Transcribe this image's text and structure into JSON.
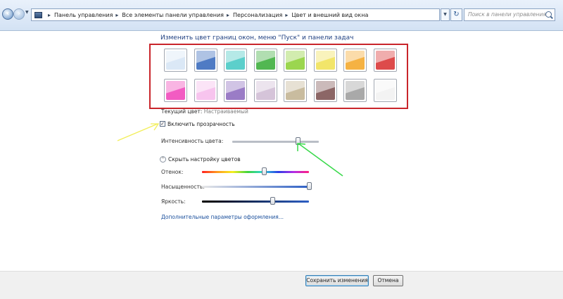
{
  "breadcrumb": [
    "Панель управления",
    "Все элементы панели управления",
    "Персонализация",
    "Цвет и внешний вид окна"
  ],
  "search": {
    "placeholder": "Поиск в панели управления"
  },
  "heading": "Изменить цвет границ окон, меню \"Пуск\" и панели задач",
  "swatches": [
    {
      "color": "#dbe8f6"
    },
    {
      "color": "#4f7bc4"
    },
    {
      "color": "#5ccfcb"
    },
    {
      "color": "#52b752"
    },
    {
      "color": "#9bd64f"
    },
    {
      "color": "#f2e56a"
    },
    {
      "color": "#f5b243"
    },
    {
      "color": "#dd4b4b"
    },
    {
      "color": "#f25cc2"
    },
    {
      "color": "#f7c4ee"
    },
    {
      "color": "#9a7cc6"
    },
    {
      "color": "#d5c4d9"
    },
    {
      "color": "#c9bc9f"
    },
    {
      "color": "#8c6666"
    },
    {
      "color": "#a9a9a9"
    },
    {
      "color": "#f3f3f3"
    }
  ],
  "current_color": {
    "label": "Текущий цвет:",
    "value": "Настраиваемый"
  },
  "transparency": {
    "label": "Включить прозрачность",
    "checked": true
  },
  "intensity": {
    "label": "Интенсивность цвета:",
    "value_percent": 76
  },
  "collapse": {
    "label": "Скрыть настройку цветов"
  },
  "hue": {
    "label": "Отенок:",
    "value_percent": 58
  },
  "saturation": {
    "label": "Насыщенность:",
    "value_percent": 100
  },
  "brightness": {
    "label": "Яркость:",
    "value_percent": 66
  },
  "advanced_link": "Дополнительные параметры оформления...",
  "buttons": {
    "save": "Сохранить изменения",
    "cancel": "Отмена"
  },
  "colors": {
    "frame_highlight": "#c9252b",
    "arrow_yellow": "#f2ee5a",
    "arrow_green": "#38d94a",
    "link": "#1a4f9c"
  }
}
